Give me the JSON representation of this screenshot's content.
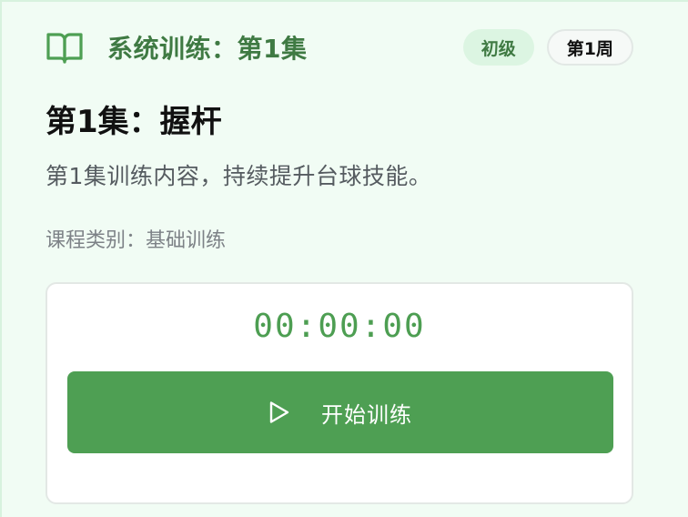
{
  "header": {
    "icon": "book-icon",
    "title": "系统训练：第1集",
    "level_badge": "初级",
    "week_badge": "第1周"
  },
  "lesson": {
    "title": "第1集：握杆",
    "description": "第1集训练内容，持续提升台球技能。",
    "category": "课程类别：基础训练"
  },
  "timer": {
    "value": "00:00:00",
    "start_button_label": "开始训练",
    "start_button_icon": "play-icon"
  },
  "colors": {
    "accent": "#4e9f53",
    "accent_dark": "#3f7a43",
    "card_bg": "#f1fcf4"
  }
}
